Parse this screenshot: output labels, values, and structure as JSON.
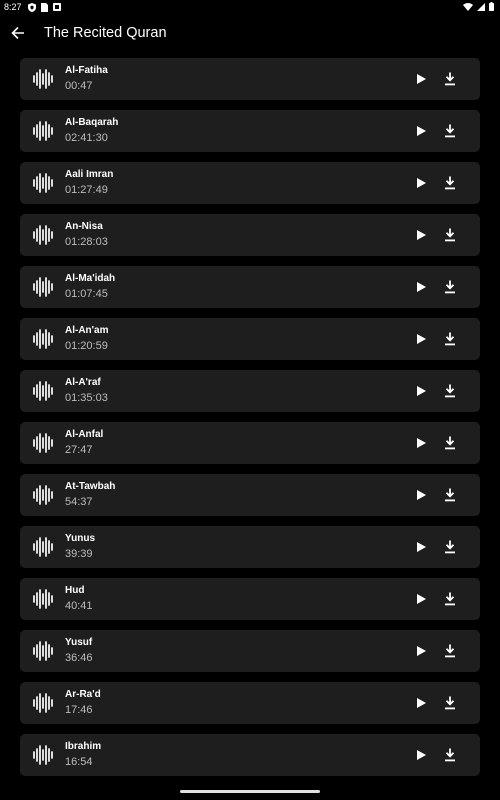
{
  "status_bar": {
    "time": "8:27"
  },
  "app_bar": {
    "title": "The Recited Quran"
  },
  "tracks": [
    {
      "name": "Al-Fatiha",
      "duration": "00:47"
    },
    {
      "name": "Al-Baqarah",
      "duration": "02:41:30"
    },
    {
      "name": "Aali Imran",
      "duration": "01:27:49"
    },
    {
      "name": "An-Nisa",
      "duration": "01:28:03"
    },
    {
      "name": "Al-Ma'idah",
      "duration": "01:07:45"
    },
    {
      "name": "Al-An'am",
      "duration": "01:20:59"
    },
    {
      "name": "Al-A'raf",
      "duration": "01:35:03"
    },
    {
      "name": "Al-Anfal",
      "duration": "27:47"
    },
    {
      "name": "At-Tawbah",
      "duration": "54:37"
    },
    {
      "name": "Yunus",
      "duration": "39:39"
    },
    {
      "name": "Hud",
      "duration": "40:41"
    },
    {
      "name": "Yusuf",
      "duration": "36:46"
    },
    {
      "name": "Ar-Ra'd",
      "duration": "17:46"
    },
    {
      "name": "Ibrahim",
      "duration": "16:54"
    }
  ],
  "icons": {
    "back": "arrow-back-icon",
    "track": "audio-wave-icon",
    "play": "play-icon",
    "download": "download-icon"
  },
  "colors": {
    "background": "#000000",
    "card": "#1e1e1e",
    "text": "#ffffff",
    "secondary_text": "#bdbdbd"
  }
}
